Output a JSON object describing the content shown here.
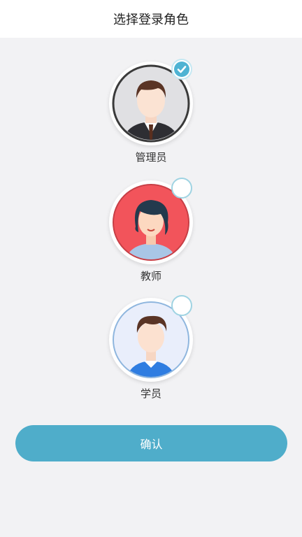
{
  "header": {
    "title": "选择登录角色"
  },
  "roles": [
    {
      "label": "管理员",
      "selected": true,
      "icon": "admin-avatar-icon"
    },
    {
      "label": "教师",
      "selected": false,
      "icon": "teacher-avatar-icon"
    },
    {
      "label": "学员",
      "selected": false,
      "icon": "student-avatar-icon"
    }
  ],
  "confirm": {
    "label": "确认"
  },
  "colors": {
    "accent": "#4fadca",
    "check": "#4eb3d3",
    "teacher_bg": "#f2545b",
    "admin_bg": "#e0e0e3",
    "student_bg": "#e9eefb"
  }
}
